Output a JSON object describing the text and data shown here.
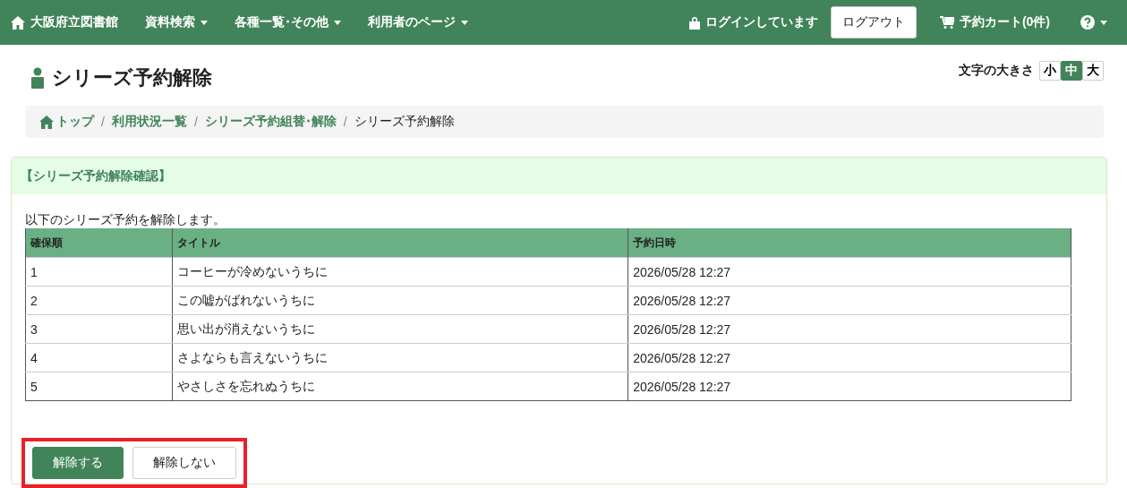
{
  "navbar": {
    "brand": "大阪府立図書館",
    "menus": [
      {
        "label": "資料検索"
      },
      {
        "label": "各種一覧･その他"
      },
      {
        "label": "利用者のページ"
      }
    ],
    "login_status": "ログインしています",
    "logout_button": "ログアウト",
    "cart": "予約カート(0件)"
  },
  "page_title": "シリーズ予約解除",
  "font_size": {
    "label": "文字の大きさ",
    "options": [
      {
        "label": "小",
        "selected": false
      },
      {
        "label": "中",
        "selected": true
      },
      {
        "label": "大",
        "selected": false
      }
    ]
  },
  "breadcrumb": [
    {
      "label": "トップ",
      "kind": "home"
    },
    {
      "label": "利用状況一覧",
      "kind": "link",
      "separator": "/"
    },
    {
      "label": "シリーズ予約組替･解除",
      "kind": "link",
      "separator": "/"
    },
    {
      "label": "シリーズ予約解除",
      "kind": "current",
      "separator": "/"
    }
  ],
  "panel": {
    "title": "【シリーズ予約解除確認】",
    "message": "以下のシリーズ予約を解除します。",
    "table": {
      "columns": [
        "確保順",
        "タイトル",
        "予約日時"
      ],
      "rows": [
        [
          "1",
          "コーヒーが冷めないうちに",
          "2026/05/28 12:27"
        ],
        [
          "2",
          "この嘘がばれないうちに",
          "2026/05/28 12:27"
        ],
        [
          "3",
          "思い出が消えないうちに",
          "2026/05/28 12:27"
        ],
        [
          "4",
          "さよならも言えないうちに",
          "2026/05/28 12:27"
        ],
        [
          "5",
          "やさしさを忘れぬうちに",
          "2026/05/28 12:27"
        ]
      ]
    },
    "actions": {
      "highlighted": true,
      "buttons": [
        {
          "label": "解除する",
          "kind": "primary"
        },
        {
          "label": "解除しない",
          "kind": "default"
        }
      ]
    }
  }
}
